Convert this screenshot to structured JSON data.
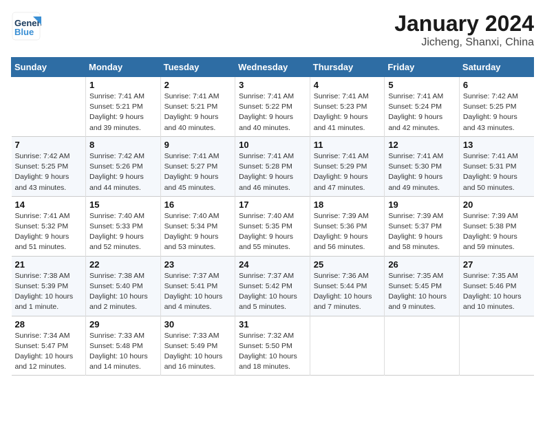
{
  "header": {
    "logo_line1": "General",
    "logo_line2": "Blue",
    "month": "January 2024",
    "location": "Jicheng, Shanxi, China"
  },
  "days_of_week": [
    "Sunday",
    "Monday",
    "Tuesday",
    "Wednesday",
    "Thursday",
    "Friday",
    "Saturday"
  ],
  "weeks": [
    [
      {
        "num": "",
        "info": ""
      },
      {
        "num": "1",
        "info": "Sunrise: 7:41 AM\nSunset: 5:21 PM\nDaylight: 9 hours\nand 39 minutes."
      },
      {
        "num": "2",
        "info": "Sunrise: 7:41 AM\nSunset: 5:21 PM\nDaylight: 9 hours\nand 40 minutes."
      },
      {
        "num": "3",
        "info": "Sunrise: 7:41 AM\nSunset: 5:22 PM\nDaylight: 9 hours\nand 40 minutes."
      },
      {
        "num": "4",
        "info": "Sunrise: 7:41 AM\nSunset: 5:23 PM\nDaylight: 9 hours\nand 41 minutes."
      },
      {
        "num": "5",
        "info": "Sunrise: 7:41 AM\nSunset: 5:24 PM\nDaylight: 9 hours\nand 42 minutes."
      },
      {
        "num": "6",
        "info": "Sunrise: 7:42 AM\nSunset: 5:25 PM\nDaylight: 9 hours\nand 43 minutes."
      }
    ],
    [
      {
        "num": "7",
        "info": "Sunrise: 7:42 AM\nSunset: 5:25 PM\nDaylight: 9 hours\nand 43 minutes."
      },
      {
        "num": "8",
        "info": "Sunrise: 7:42 AM\nSunset: 5:26 PM\nDaylight: 9 hours\nand 44 minutes."
      },
      {
        "num": "9",
        "info": "Sunrise: 7:41 AM\nSunset: 5:27 PM\nDaylight: 9 hours\nand 45 minutes."
      },
      {
        "num": "10",
        "info": "Sunrise: 7:41 AM\nSunset: 5:28 PM\nDaylight: 9 hours\nand 46 minutes."
      },
      {
        "num": "11",
        "info": "Sunrise: 7:41 AM\nSunset: 5:29 PM\nDaylight: 9 hours\nand 47 minutes."
      },
      {
        "num": "12",
        "info": "Sunrise: 7:41 AM\nSunset: 5:30 PM\nDaylight: 9 hours\nand 49 minutes."
      },
      {
        "num": "13",
        "info": "Sunrise: 7:41 AM\nSunset: 5:31 PM\nDaylight: 9 hours\nand 50 minutes."
      }
    ],
    [
      {
        "num": "14",
        "info": "Sunrise: 7:41 AM\nSunset: 5:32 PM\nDaylight: 9 hours\nand 51 minutes."
      },
      {
        "num": "15",
        "info": "Sunrise: 7:40 AM\nSunset: 5:33 PM\nDaylight: 9 hours\nand 52 minutes."
      },
      {
        "num": "16",
        "info": "Sunrise: 7:40 AM\nSunset: 5:34 PM\nDaylight: 9 hours\nand 53 minutes."
      },
      {
        "num": "17",
        "info": "Sunrise: 7:40 AM\nSunset: 5:35 PM\nDaylight: 9 hours\nand 55 minutes."
      },
      {
        "num": "18",
        "info": "Sunrise: 7:39 AM\nSunset: 5:36 PM\nDaylight: 9 hours\nand 56 minutes."
      },
      {
        "num": "19",
        "info": "Sunrise: 7:39 AM\nSunset: 5:37 PM\nDaylight: 9 hours\nand 58 minutes."
      },
      {
        "num": "20",
        "info": "Sunrise: 7:39 AM\nSunset: 5:38 PM\nDaylight: 9 hours\nand 59 minutes."
      }
    ],
    [
      {
        "num": "21",
        "info": "Sunrise: 7:38 AM\nSunset: 5:39 PM\nDaylight: 10 hours\nand 1 minute."
      },
      {
        "num": "22",
        "info": "Sunrise: 7:38 AM\nSunset: 5:40 PM\nDaylight: 10 hours\nand 2 minutes."
      },
      {
        "num": "23",
        "info": "Sunrise: 7:37 AM\nSunset: 5:41 PM\nDaylight: 10 hours\nand 4 minutes."
      },
      {
        "num": "24",
        "info": "Sunrise: 7:37 AM\nSunset: 5:42 PM\nDaylight: 10 hours\nand 5 minutes."
      },
      {
        "num": "25",
        "info": "Sunrise: 7:36 AM\nSunset: 5:44 PM\nDaylight: 10 hours\nand 7 minutes."
      },
      {
        "num": "26",
        "info": "Sunrise: 7:35 AM\nSunset: 5:45 PM\nDaylight: 10 hours\nand 9 minutes."
      },
      {
        "num": "27",
        "info": "Sunrise: 7:35 AM\nSunset: 5:46 PM\nDaylight: 10 hours\nand 10 minutes."
      }
    ],
    [
      {
        "num": "28",
        "info": "Sunrise: 7:34 AM\nSunset: 5:47 PM\nDaylight: 10 hours\nand 12 minutes."
      },
      {
        "num": "29",
        "info": "Sunrise: 7:33 AM\nSunset: 5:48 PM\nDaylight: 10 hours\nand 14 minutes."
      },
      {
        "num": "30",
        "info": "Sunrise: 7:33 AM\nSunset: 5:49 PM\nDaylight: 10 hours\nand 16 minutes."
      },
      {
        "num": "31",
        "info": "Sunrise: 7:32 AM\nSunset: 5:50 PM\nDaylight: 10 hours\nand 18 minutes."
      },
      {
        "num": "",
        "info": ""
      },
      {
        "num": "",
        "info": ""
      },
      {
        "num": "",
        "info": ""
      }
    ]
  ]
}
